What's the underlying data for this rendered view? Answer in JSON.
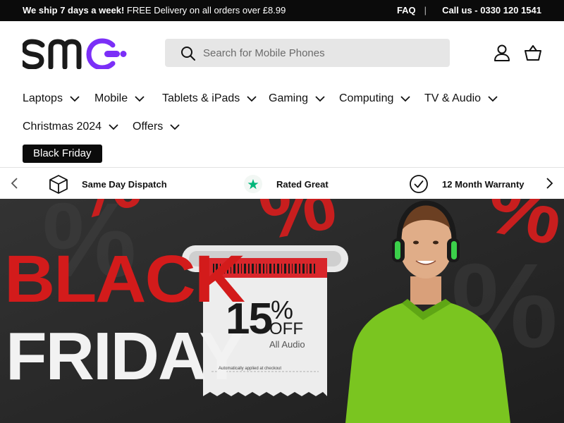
{
  "announcement": {
    "shipping_bold": "We ship 7 days a week!",
    "shipping_text": "FREE Delivery on all orders over £8.99",
    "faq_label": "FAQ",
    "separator": "|",
    "call_label": "Call us - 0330 120 1541"
  },
  "header": {
    "logo_alt": "smc",
    "search_placeholder": "Search for Mobile Phones",
    "search_icon": "search-icon",
    "account_icon": "user-icon",
    "cart_icon": "basket-icon"
  },
  "nav": {
    "items": [
      {
        "label": "Laptops"
      },
      {
        "label": "Mobile"
      },
      {
        "label": "Tablets & iPads"
      },
      {
        "label": "Gaming"
      },
      {
        "label": "Computing"
      },
      {
        "label": "TV & Audio"
      },
      {
        "label": "Christmas 2024"
      },
      {
        "label": "Offers"
      }
    ],
    "highlight_label": "Black Friday"
  },
  "usp": {
    "items": [
      {
        "label": "Same Day Dispatch",
        "icon": "box-icon"
      },
      {
        "label": "Rated Great",
        "icon": "star-icon"
      },
      {
        "label": "12 Month Warranty",
        "icon": "check-circle-icon"
      }
    ],
    "prev_icon": "chevron-left-icon",
    "next_icon": "chevron-right-icon"
  },
  "hero": {
    "title_line1": "BLACK",
    "title_line2": "FRIDAY",
    "discount_number": "15",
    "discount_percent": "%",
    "discount_off": "OFF",
    "discount_scope": "All Audio",
    "discount_note": "Automatically applied at checkout"
  },
  "colors": {
    "brand_dark": "#0b0b0b",
    "brand_purple": "#7b2ff7",
    "hero_red": "#d31b1b",
    "hero_bg": "#2a2a2a",
    "shirt_green": "#7ac520",
    "star_green": "#00b67a"
  }
}
